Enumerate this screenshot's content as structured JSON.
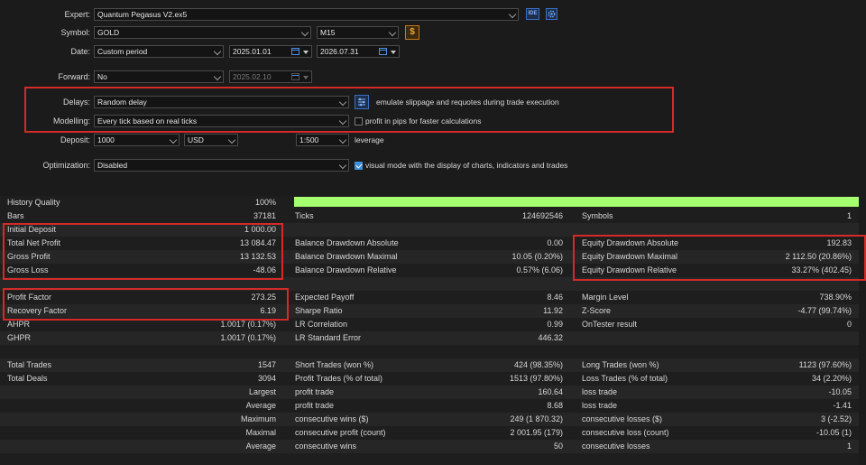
{
  "settings": {
    "expert": {
      "label": "Expert:",
      "value": "Quantum Pegasus V2.ex5"
    },
    "symbol": {
      "label": "Symbol:",
      "value": "GOLD",
      "timeframe": "M15"
    },
    "date": {
      "label": "Date:",
      "period": "Custom period",
      "from": "2025.01.01",
      "to": "2026.07.31"
    },
    "forward": {
      "label": "Forward:",
      "value": "No",
      "date": "2025.02.10"
    },
    "delays": {
      "label": "Delays:",
      "value": "Random delay",
      "note": "emulate slippage and requotes during trade execution"
    },
    "modelling": {
      "label": "Modelling:",
      "value": "Every tick based on real ticks",
      "check_label": "profit in pips for faster calculations"
    },
    "deposit": {
      "label": "Deposit:",
      "amount": "1000",
      "currency": "USD",
      "leverage": "1:500",
      "leverage_label": "leverage"
    },
    "optimization": {
      "label": "Optimization:",
      "value": "Disabled",
      "check_label": "visual mode with the display of charts, indicators and trades"
    },
    "ide_label": "IDE",
    "symbol_btn": "$"
  },
  "colors": {
    "accent": "#3e8fd8",
    "highlight": "#d42a2a",
    "quality_bar": "#a6ff6e"
  },
  "results": {
    "history_quality": {
      "label": "History Quality",
      "value": "100%",
      "fill": 1.0
    },
    "rows": [
      {
        "alt": false,
        "c1": [
          "Bars",
          "37181"
        ],
        "c2": [
          "Ticks",
          "124692546"
        ],
        "c3": [
          "Symbols",
          "1"
        ]
      },
      {
        "alt": true,
        "c1": [
          "Initial Deposit",
          "1 000.00"
        ],
        "c2": [
          "",
          ""
        ],
        "c3": [
          "",
          ""
        ]
      },
      {
        "alt": false,
        "c1": [
          "Total Net Profit",
          "13 084.47"
        ],
        "c2": [
          "Balance Drawdown Absolute",
          "0.00"
        ],
        "c3": [
          "Equity Drawdown Absolute",
          "192.83"
        ]
      },
      {
        "alt": true,
        "c1": [
          "Gross Profit",
          "13 132.53"
        ],
        "c2": [
          "Balance Drawdown Maximal",
          "10.05 (0.20%)"
        ],
        "c3": [
          "Equity Drawdown Maximal",
          "2 112.50 (20.86%)"
        ]
      },
      {
        "alt": false,
        "c1": [
          "Gross Loss",
          "-48.06"
        ],
        "c2": [
          "Balance Drawdown Relative",
          "0.57% (6.06)"
        ],
        "c3": [
          "Equity Drawdown Relative",
          "33.27% (402.45)"
        ]
      },
      {
        "alt": true,
        "c1": [
          "",
          ""
        ],
        "c2": [
          "",
          ""
        ],
        "c3": [
          "",
          ""
        ]
      },
      {
        "alt": false,
        "c1": [
          "Profit Factor",
          "273.25"
        ],
        "c2": [
          "Expected Payoff",
          "8.46"
        ],
        "c3": [
          "Margin Level",
          "738.90%"
        ]
      },
      {
        "alt": true,
        "c1": [
          "Recovery Factor",
          "6.19"
        ],
        "c2": [
          "Sharpe Ratio",
          "11.92"
        ],
        "c3": [
          "Z-Score",
          "-4.77 (99.74%)"
        ]
      },
      {
        "alt": false,
        "c1": [
          "AHPR",
          "1.0017 (0.17%)"
        ],
        "c2": [
          "LR Correlation",
          "0.99"
        ],
        "c3": [
          "OnTester result",
          "0"
        ]
      },
      {
        "alt": true,
        "c1": [
          "GHPR",
          "1.0017 (0.17%)"
        ],
        "c2": [
          "LR Standard Error",
          "446.32"
        ],
        "c3": [
          "",
          ""
        ]
      },
      {
        "alt": false,
        "c1": [
          "",
          ""
        ],
        "c2": [
          "",
          ""
        ],
        "c3": [
          "",
          ""
        ]
      },
      {
        "alt": true,
        "c1": [
          "Total Trades",
          "1547"
        ],
        "c2": [
          "Short Trades (won %)",
          "424 (98.35%)"
        ],
        "c3": [
          "Long Trades (won %)",
          "1123 (97.60%)"
        ]
      },
      {
        "alt": false,
        "c1": [
          "Total Deals",
          "3094"
        ],
        "c2": [
          "Profit Trades (% of total)",
          "1513 (97.80%)"
        ],
        "c3": [
          "Loss Trades (% of total)",
          "34 (2.20%)"
        ]
      },
      {
        "alt": true,
        "c1": [
          "",
          "Largest"
        ],
        "c2": [
          "profit trade",
          "160.64"
        ],
        "c3": [
          "loss trade",
          "-10.05"
        ]
      },
      {
        "alt": false,
        "c1": [
          "",
          "Average"
        ],
        "c2": [
          "profit trade",
          "8.68"
        ],
        "c3": [
          "loss trade",
          "-1.41"
        ]
      },
      {
        "alt": true,
        "c1": [
          "",
          "Maximum"
        ],
        "c2": [
          "consecutive wins ($)",
          "249 (1 870.32)"
        ],
        "c3": [
          "consecutive losses ($)",
          "3 (-2.52)"
        ]
      },
      {
        "alt": false,
        "c1": [
          "",
          "Maximal"
        ],
        "c2": [
          "consecutive profit (count)",
          "2 001.95 (179)"
        ],
        "c3": [
          "consecutive loss (count)",
          "-10.05 (1)"
        ]
      },
      {
        "alt": true,
        "c1": [
          "",
          "Average"
        ],
        "c2": [
          "consecutive wins",
          "50"
        ],
        "c3": [
          "consecutive losses",
          "1"
        ]
      }
    ]
  }
}
